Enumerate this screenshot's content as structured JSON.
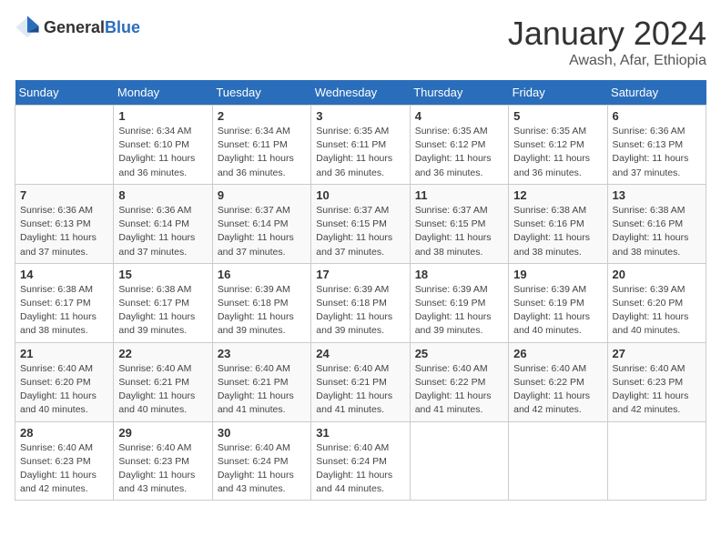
{
  "header": {
    "logo_general": "General",
    "logo_blue": "Blue",
    "title": "January 2024",
    "location": "Awash, Afar, Ethiopia"
  },
  "days_of_week": [
    "Sunday",
    "Monday",
    "Tuesday",
    "Wednesday",
    "Thursday",
    "Friday",
    "Saturday"
  ],
  "weeks": [
    [
      {
        "day": "",
        "info": ""
      },
      {
        "day": "1",
        "info": "Sunrise: 6:34 AM\nSunset: 6:10 PM\nDaylight: 11 hours and 36 minutes."
      },
      {
        "day": "2",
        "info": "Sunrise: 6:34 AM\nSunset: 6:11 PM\nDaylight: 11 hours and 36 minutes."
      },
      {
        "day": "3",
        "info": "Sunrise: 6:35 AM\nSunset: 6:11 PM\nDaylight: 11 hours and 36 minutes."
      },
      {
        "day": "4",
        "info": "Sunrise: 6:35 AM\nSunset: 6:12 PM\nDaylight: 11 hours and 36 minutes."
      },
      {
        "day": "5",
        "info": "Sunrise: 6:35 AM\nSunset: 6:12 PM\nDaylight: 11 hours and 36 minutes."
      },
      {
        "day": "6",
        "info": "Sunrise: 6:36 AM\nSunset: 6:13 PM\nDaylight: 11 hours and 37 minutes."
      }
    ],
    [
      {
        "day": "7",
        "info": "Sunrise: 6:36 AM\nSunset: 6:13 PM\nDaylight: 11 hours and 37 minutes."
      },
      {
        "day": "8",
        "info": "Sunrise: 6:36 AM\nSunset: 6:14 PM\nDaylight: 11 hours and 37 minutes."
      },
      {
        "day": "9",
        "info": "Sunrise: 6:37 AM\nSunset: 6:14 PM\nDaylight: 11 hours and 37 minutes."
      },
      {
        "day": "10",
        "info": "Sunrise: 6:37 AM\nSunset: 6:15 PM\nDaylight: 11 hours and 37 minutes."
      },
      {
        "day": "11",
        "info": "Sunrise: 6:37 AM\nSunset: 6:15 PM\nDaylight: 11 hours and 38 minutes."
      },
      {
        "day": "12",
        "info": "Sunrise: 6:38 AM\nSunset: 6:16 PM\nDaylight: 11 hours and 38 minutes."
      },
      {
        "day": "13",
        "info": "Sunrise: 6:38 AM\nSunset: 6:16 PM\nDaylight: 11 hours and 38 minutes."
      }
    ],
    [
      {
        "day": "14",
        "info": "Sunrise: 6:38 AM\nSunset: 6:17 PM\nDaylight: 11 hours and 38 minutes."
      },
      {
        "day": "15",
        "info": "Sunrise: 6:38 AM\nSunset: 6:17 PM\nDaylight: 11 hours and 39 minutes."
      },
      {
        "day": "16",
        "info": "Sunrise: 6:39 AM\nSunset: 6:18 PM\nDaylight: 11 hours and 39 minutes."
      },
      {
        "day": "17",
        "info": "Sunrise: 6:39 AM\nSunset: 6:18 PM\nDaylight: 11 hours and 39 minutes."
      },
      {
        "day": "18",
        "info": "Sunrise: 6:39 AM\nSunset: 6:19 PM\nDaylight: 11 hours and 39 minutes."
      },
      {
        "day": "19",
        "info": "Sunrise: 6:39 AM\nSunset: 6:19 PM\nDaylight: 11 hours and 40 minutes."
      },
      {
        "day": "20",
        "info": "Sunrise: 6:39 AM\nSunset: 6:20 PM\nDaylight: 11 hours and 40 minutes."
      }
    ],
    [
      {
        "day": "21",
        "info": "Sunrise: 6:40 AM\nSunset: 6:20 PM\nDaylight: 11 hours and 40 minutes."
      },
      {
        "day": "22",
        "info": "Sunrise: 6:40 AM\nSunset: 6:21 PM\nDaylight: 11 hours and 40 minutes."
      },
      {
        "day": "23",
        "info": "Sunrise: 6:40 AM\nSunset: 6:21 PM\nDaylight: 11 hours and 41 minutes."
      },
      {
        "day": "24",
        "info": "Sunrise: 6:40 AM\nSunset: 6:21 PM\nDaylight: 11 hours and 41 minutes."
      },
      {
        "day": "25",
        "info": "Sunrise: 6:40 AM\nSunset: 6:22 PM\nDaylight: 11 hours and 41 minutes."
      },
      {
        "day": "26",
        "info": "Sunrise: 6:40 AM\nSunset: 6:22 PM\nDaylight: 11 hours and 42 minutes."
      },
      {
        "day": "27",
        "info": "Sunrise: 6:40 AM\nSunset: 6:23 PM\nDaylight: 11 hours and 42 minutes."
      }
    ],
    [
      {
        "day": "28",
        "info": "Sunrise: 6:40 AM\nSunset: 6:23 PM\nDaylight: 11 hours and 42 minutes."
      },
      {
        "day": "29",
        "info": "Sunrise: 6:40 AM\nSunset: 6:23 PM\nDaylight: 11 hours and 43 minutes."
      },
      {
        "day": "30",
        "info": "Sunrise: 6:40 AM\nSunset: 6:24 PM\nDaylight: 11 hours and 43 minutes."
      },
      {
        "day": "31",
        "info": "Sunrise: 6:40 AM\nSunset: 6:24 PM\nDaylight: 11 hours and 44 minutes."
      },
      {
        "day": "",
        "info": ""
      },
      {
        "day": "",
        "info": ""
      },
      {
        "day": "",
        "info": ""
      }
    ]
  ]
}
